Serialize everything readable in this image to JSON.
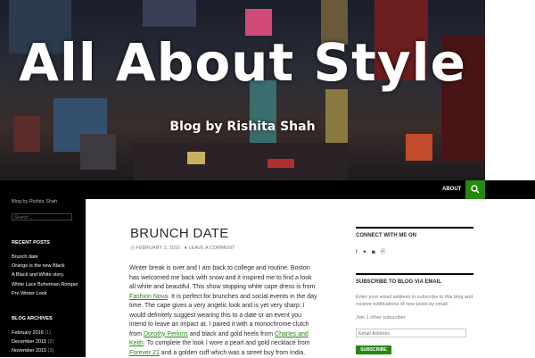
{
  "site": {
    "title": "All About Style",
    "tagline": "Blog by Rishita Shah"
  },
  "nav": {
    "about_label": "ABOUT",
    "search_icon": "search-icon"
  },
  "sidebar": {
    "description": "Blog by Rishita Shah",
    "search_placeholder": "Search …",
    "recent_posts": {
      "heading": "RECENT POSTS",
      "items": [
        "Brunch date",
        "Orange is the new Black",
        "A Black and White story.",
        "White Lace Bohemian Romper",
        "Pre Winter Look"
      ]
    },
    "archives": {
      "heading": "BLOG ARCHIVES",
      "items": [
        {
          "label": "February 2016",
          "count": "(1)"
        },
        {
          "label": "December 2015",
          "count": "(2)"
        },
        {
          "label": "November 2015",
          "count": "(3)"
        }
      ]
    }
  },
  "post": {
    "title": "BRUNCH DATE",
    "date": "FEBRUARY 2, 2016",
    "comment_link": "LEAVE A COMMENT",
    "body": {
      "p1": "Winter break is over and I am back to college and routine. Boston has welcomed me back with snow and it inspired me to find a look all white and beautiful. This show stopping white cape dress is from ",
      "link1": "Fashion Nova",
      "p2": ". It is perfect for brunches and social events in the day time. The cape gives a very angelic look and is yet very sharp. I would definitely suggest wearing this to a date or an event you intend to leave an impact at. I paired it with a monochrome clutch from ",
      "link2": "Dorothy Perkins",
      "p3": " and black and gold heels from ",
      "link3": "Charles and Keith",
      "p4": ". To complete the look I wore a pearl and gold necklace from ",
      "link4": "Forever 21",
      "p5": " and a golden cuff which was a street buy from India."
    }
  },
  "widgets": {
    "connect": {
      "heading": "CONNECT WITH ME ON",
      "icons": [
        "facebook-icon",
        "twitter-icon",
        "instagram-icon",
        "pinterest-icon"
      ]
    },
    "subscribe": {
      "heading": "SUBSCRIBE TO BLOG VIA EMAIL",
      "intro": "Enter your email address to subscribe to this blog and receive notifications of new posts by email.",
      "subscribers": "Join 1 other subscriber",
      "email_placeholder": "Email Address",
      "button_label": "SUBSCRIBE"
    }
  },
  "colors": {
    "accent": "#24890d",
    "nav_bg": "#000000",
    "text": "#2b2b2b",
    "muted": "#767676"
  }
}
